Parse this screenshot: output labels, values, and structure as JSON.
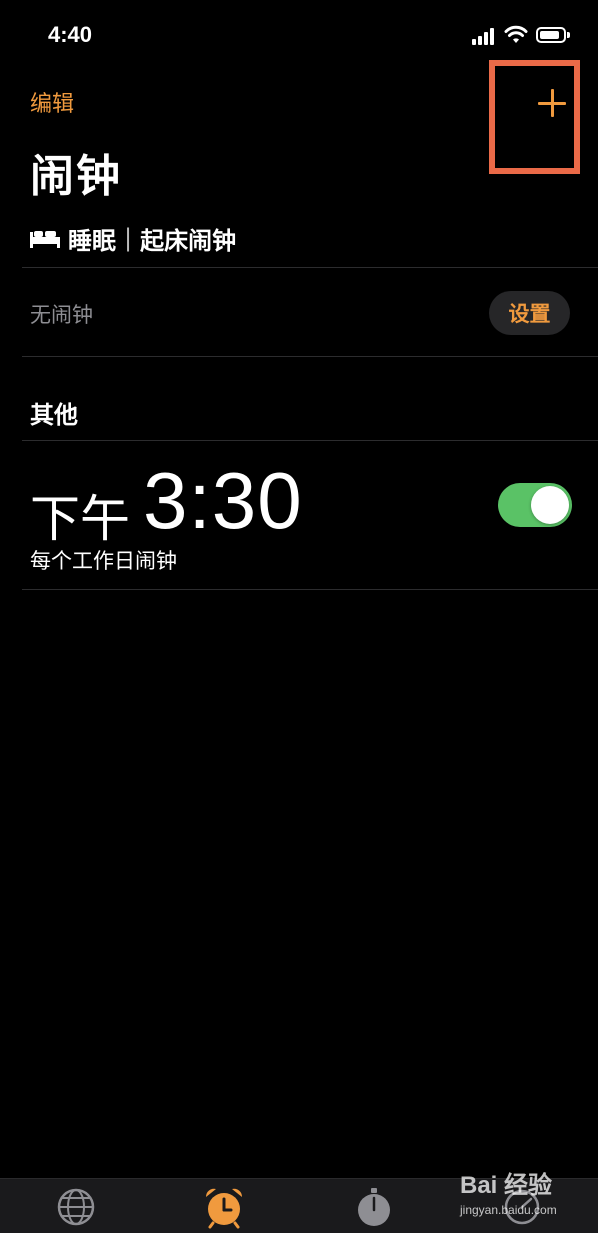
{
  "status_bar": {
    "time": "4:40",
    "icons": [
      "signal-icon",
      "wifi-icon",
      "battery-icon"
    ],
    "battery_level": 0.85
  },
  "header": {
    "edit_label": "编辑",
    "add_icon": "plus-icon",
    "title": "闹钟"
  },
  "sleep": {
    "icon": "bed-icon",
    "label": "睡眠",
    "divider": "|",
    "wake_label": "起床闹钟",
    "status": "无闹钟",
    "setup_label": "设置"
  },
  "other": {
    "header": "其他",
    "alarms": [
      {
        "period": "下午",
        "time": "3:30",
        "label": "每个工作日闹钟",
        "enabled": true
      }
    ]
  },
  "tab_bar": {
    "tabs": [
      {
        "name": "world-clock",
        "icon": "globe-icon",
        "active": false
      },
      {
        "name": "alarm",
        "icon": "alarm-clock-icon",
        "active": true
      },
      {
        "name": "stopwatch",
        "icon": "stopwatch-icon",
        "active": false
      },
      {
        "name": "timer",
        "icon": "timer-icon",
        "active": false
      }
    ]
  },
  "watermark": {
    "logo": "Bai 经验",
    "sub": "jingyan.baidu.com"
  },
  "colors": {
    "accent": "#f09a3e",
    "toggle_on": "#5ac266",
    "highlight_box": "#ea6a48",
    "background": "#000000"
  }
}
